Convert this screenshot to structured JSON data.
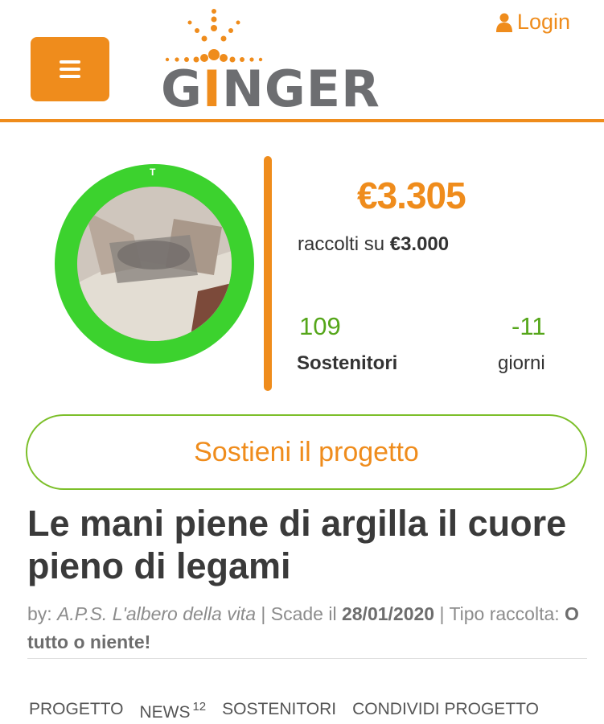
{
  "header": {
    "logo_text": "GINGER",
    "login_label": "Login",
    "brand_color": "#ef8c1c"
  },
  "campaign": {
    "amount_raised": "€3.305",
    "raised_prefix": "raccolti su",
    "goal": "€3.000",
    "supporters_count": "109",
    "supporters_label": "Sostenitori",
    "days_count": "-11",
    "days_label": "giorni",
    "progress_ring_color": "#3cd22e"
  },
  "cta": {
    "support_label": "Sostieni il progetto"
  },
  "project": {
    "title": "Le mani piene di argilla il cuore pieno di legami",
    "by_label": "by:",
    "author": "A.P.S. L'albero della vita",
    "sep1": "|",
    "deadline_label": "Scade il",
    "deadline": "28/01/2020",
    "sep2": "|",
    "type_label": "Tipo raccolta:",
    "type_value": "O tutto o niente!"
  },
  "tabs": [
    {
      "label": "PROGETTO"
    },
    {
      "label": "NEWS",
      "badge": "12"
    },
    {
      "label": "SOSTENITORI"
    },
    {
      "label": "CONDIVIDI PROGETTO"
    }
  ]
}
